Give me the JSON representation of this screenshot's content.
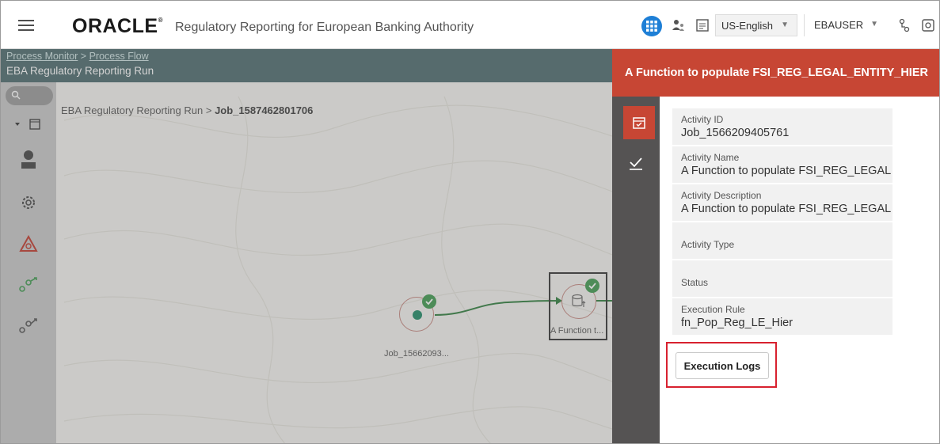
{
  "header": {
    "brand": "ORACLE",
    "brand_mark": "®",
    "app_title": "Regulatory Reporting for European Banking Authority",
    "language": "US-English",
    "user": "EBAUSER",
    "icons": [
      "menu-icon",
      "apps-grid-icon",
      "user-roles-icon",
      "notes-icon",
      "sitemap-icon",
      "screen-icon"
    ]
  },
  "workspace": {
    "breadcrumb": {
      "item1": "Process Monitor",
      "separator": ">",
      "item2": "Process Flow"
    },
    "title": "EBA Regulatory Reporting Run",
    "path": {
      "parent": "EBA Regulatory Reporting Run",
      "separator": ">",
      "current": "Job_1587462801706"
    },
    "nodes": [
      {
        "label": "Job_15662093..."
      },
      {
        "label": "A Function t..."
      }
    ]
  },
  "drawer": {
    "title": "A Function to populate FSI_REG_LEGAL_ENTITY_HIER",
    "fields": [
      {
        "label": "Activity ID",
        "value": "Job_1566209405761"
      },
      {
        "label": "Activity Name",
        "value": "A Function to populate FSI_REG_LEGAL"
      },
      {
        "label": "Activity Description",
        "value": "A Function to populate FSI_REG_LEGAL"
      },
      {
        "label": "Activity Type",
        "value": ""
      },
      {
        "label": "Status",
        "value": ""
      },
      {
        "label": "Execution Rule",
        "value": "fn_Pop_Reg_LE_Hier"
      }
    ],
    "execution_logs_label": "Execution Logs"
  },
  "colors": {
    "accent": "#c74634",
    "highlight_box": "#d8212f",
    "status_success": "#3f9a4f",
    "rail": "#555353",
    "apps_button": "#1e7fd6"
  }
}
